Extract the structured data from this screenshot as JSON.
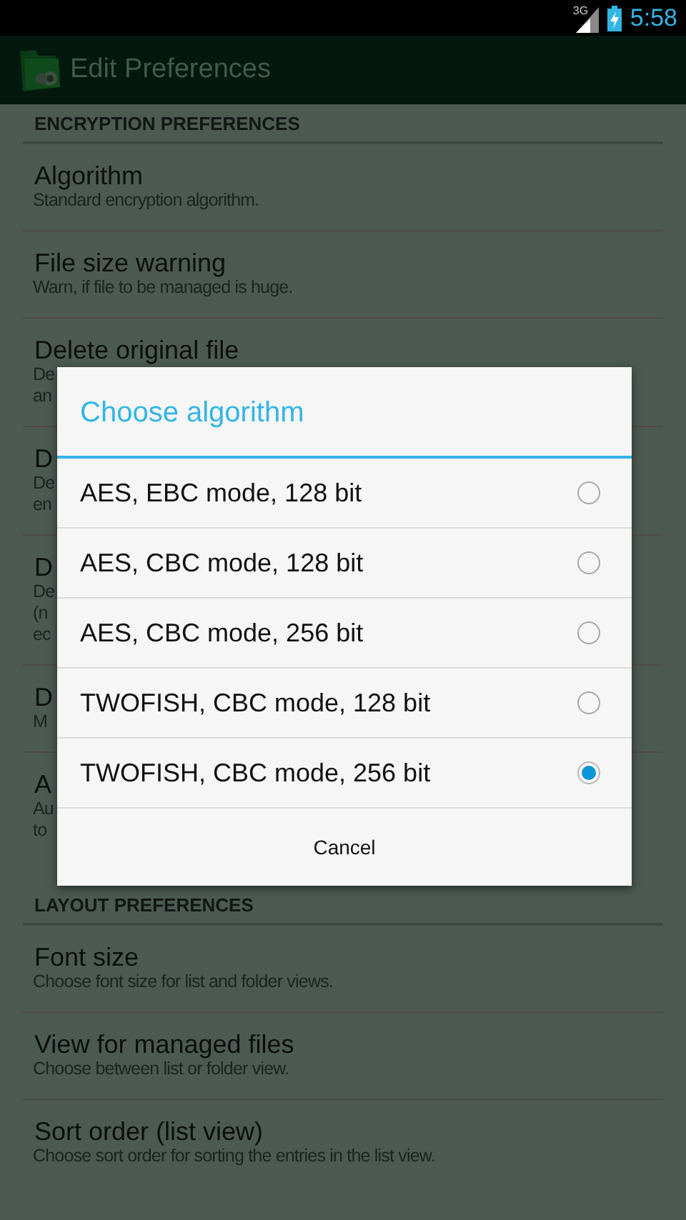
{
  "status_bar": {
    "network": "3G",
    "time": "5:58"
  },
  "app_bar": {
    "title": "Edit Preferences"
  },
  "sections": [
    {
      "header": "ENCRYPTION PREFERENCES",
      "items": [
        {
          "title": "Algorithm",
          "summary": [
            "Standard encryption algorithm."
          ]
        },
        {
          "title": "File size warning",
          "summary": [
            "Warn, if file to be managed is huge."
          ]
        },
        {
          "title": "Delete original file",
          "summary": [
            "De",
            "an"
          ]
        },
        {
          "title": "D",
          "summary": [
            "De",
            "en"
          ]
        },
        {
          "title": "D",
          "summary": [
            "De",
            "(n",
            "ec"
          ]
        },
        {
          "title": "D",
          "summary": [
            "M"
          ]
        },
        {
          "title": "A",
          "summary": [
            "Au",
            "to"
          ]
        }
      ]
    },
    {
      "header": "LAYOUT PREFERENCES",
      "items": [
        {
          "title": "Font size",
          "summary": [
            "Choose font size for list and folder views."
          ]
        },
        {
          "title": "View for managed files",
          "summary": [
            "Choose between list or folder view."
          ]
        },
        {
          "title": "Sort order (list view)",
          "summary": [
            "Choose sort order for sorting the entries in the list view."
          ]
        }
      ]
    }
  ],
  "dialog": {
    "title": "Choose algorithm",
    "options": [
      {
        "label": "AES, EBC mode, 128 bit",
        "selected": false
      },
      {
        "label": "AES, CBC mode, 128 bit",
        "selected": false
      },
      {
        "label": "AES, CBC mode, 256 bit",
        "selected": false
      },
      {
        "label": "TWOFISH, CBC mode, 128 bit",
        "selected": false
      },
      {
        "label": "TWOFISH, CBC mode, 256 bit",
        "selected": true
      }
    ],
    "cancel": "Cancel"
  }
}
